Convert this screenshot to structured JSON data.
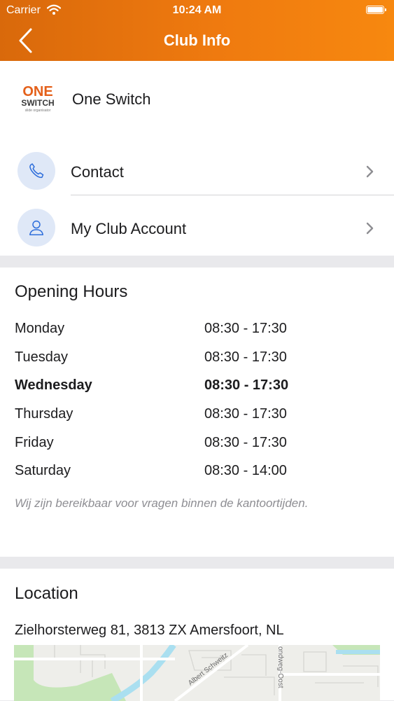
{
  "status_bar": {
    "carrier": "Carrier",
    "time": "10:24 AM"
  },
  "nav": {
    "title": "Club Info"
  },
  "club": {
    "logo": {
      "line1": "ONE",
      "line2": "SWITCH",
      "tagline": "slide organisator"
    },
    "name": "One Switch",
    "rows": [
      {
        "label": "Contact",
        "icon": "phone-icon"
      },
      {
        "label": "My Club Account",
        "icon": "user-icon"
      }
    ]
  },
  "opening_hours": {
    "title": "Opening Hours",
    "days": [
      {
        "day": "Monday",
        "hours": "08:30 - 17:30"
      },
      {
        "day": "Tuesday",
        "hours": "08:30 - 17:30"
      },
      {
        "day": "Wednesday",
        "hours": "08:30 - 17:30"
      },
      {
        "day": "Thursday",
        "hours": "08:30 - 17:30"
      },
      {
        "day": "Friday",
        "hours": "08:30 - 17:30"
      },
      {
        "day": "Saturday",
        "hours": "08:30 - 14:00"
      }
    ],
    "highlighted_day": "Wednesday",
    "note": "Wij zijn bereikbaar voor vragen binnen de kantoortijden."
  },
  "location": {
    "title": "Location",
    "address": "Zielhorsterweg 81, 3813 ZX Amersfoort, NL",
    "map_labels": {
      "street1": "Albert Schweitz",
      "street2": "ondweg-Oost"
    }
  },
  "colors": {
    "accent_orange": "#ef7a0f",
    "icon_blue": "#2f6fdb",
    "icon_bg": "#dfe8f7",
    "map_green": "#c6e6b8",
    "map_water": "#aadff0"
  }
}
